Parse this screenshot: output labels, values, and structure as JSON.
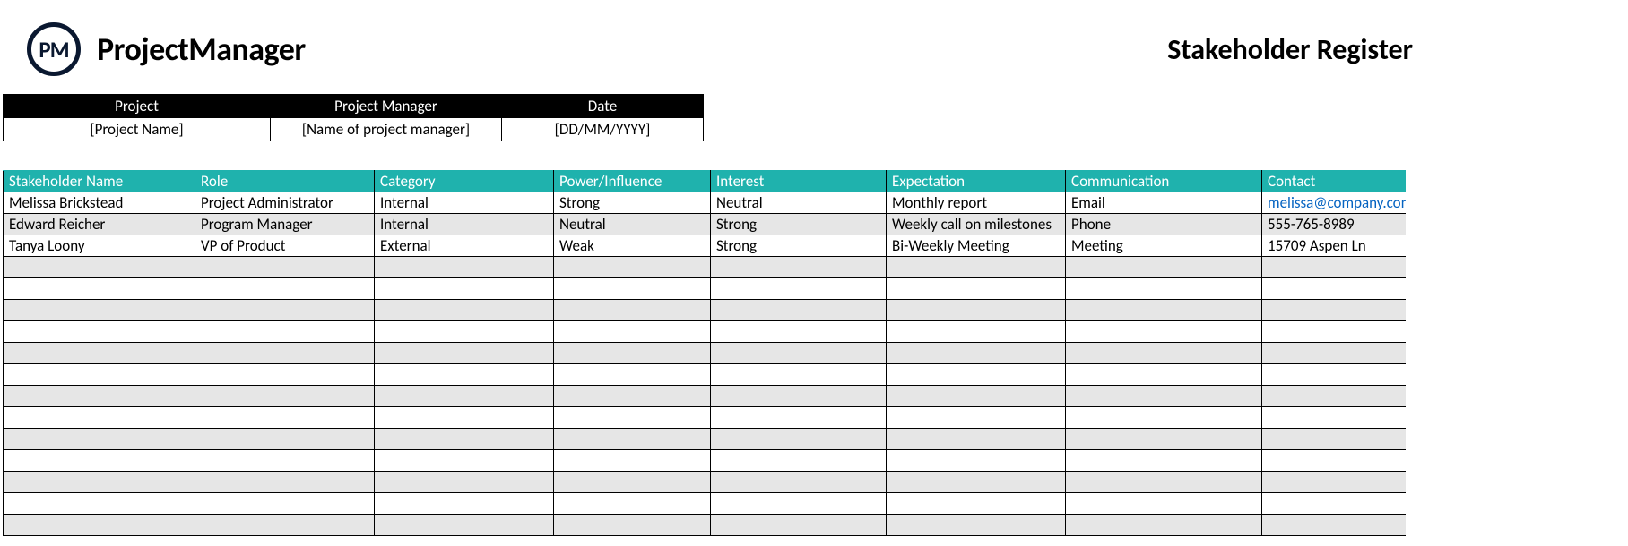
{
  "brand": {
    "logo_initials": "PM",
    "logo_text": "ProjectManager"
  },
  "document_title": "Stakeholder Register",
  "meta": {
    "headers": [
      "Project",
      "Project Manager",
      "Date"
    ],
    "values": [
      "[Project Name]",
      "[Name of project manager]",
      "[DD/MM/YYYY]"
    ]
  },
  "table": {
    "headers": [
      "Stakeholder Name",
      "Role",
      "Category",
      "Power/Influence",
      "Interest",
      "Expectation",
      "Communication",
      "Contact"
    ],
    "rows": [
      {
        "name": "Melissa Brickstead",
        "role": "Project Administrator",
        "category": "Internal",
        "power": "Strong",
        "interest": "Neutral",
        "expectation": "Monthly report",
        "communication": "Email",
        "contact": "melissa@company.com",
        "contact_is_link": true
      },
      {
        "name": "Edward Reicher",
        "role": "Program Manager",
        "category": "Internal",
        "power": "Neutral",
        "interest": "Strong",
        "expectation": "Weekly call on milestones",
        "communication": "Phone",
        "contact": "555-765-8989",
        "contact_is_link": false
      },
      {
        "name": "Tanya Loony",
        "role": "VP of Product",
        "category": "External",
        "power": "Weak",
        "interest": "Strong",
        "expectation": "Bi-Weekly Meeting",
        "communication": "Meeting",
        "contact": "15709 Aspen Ln",
        "contact_is_link": false
      }
    ],
    "empty_rows": 13
  }
}
